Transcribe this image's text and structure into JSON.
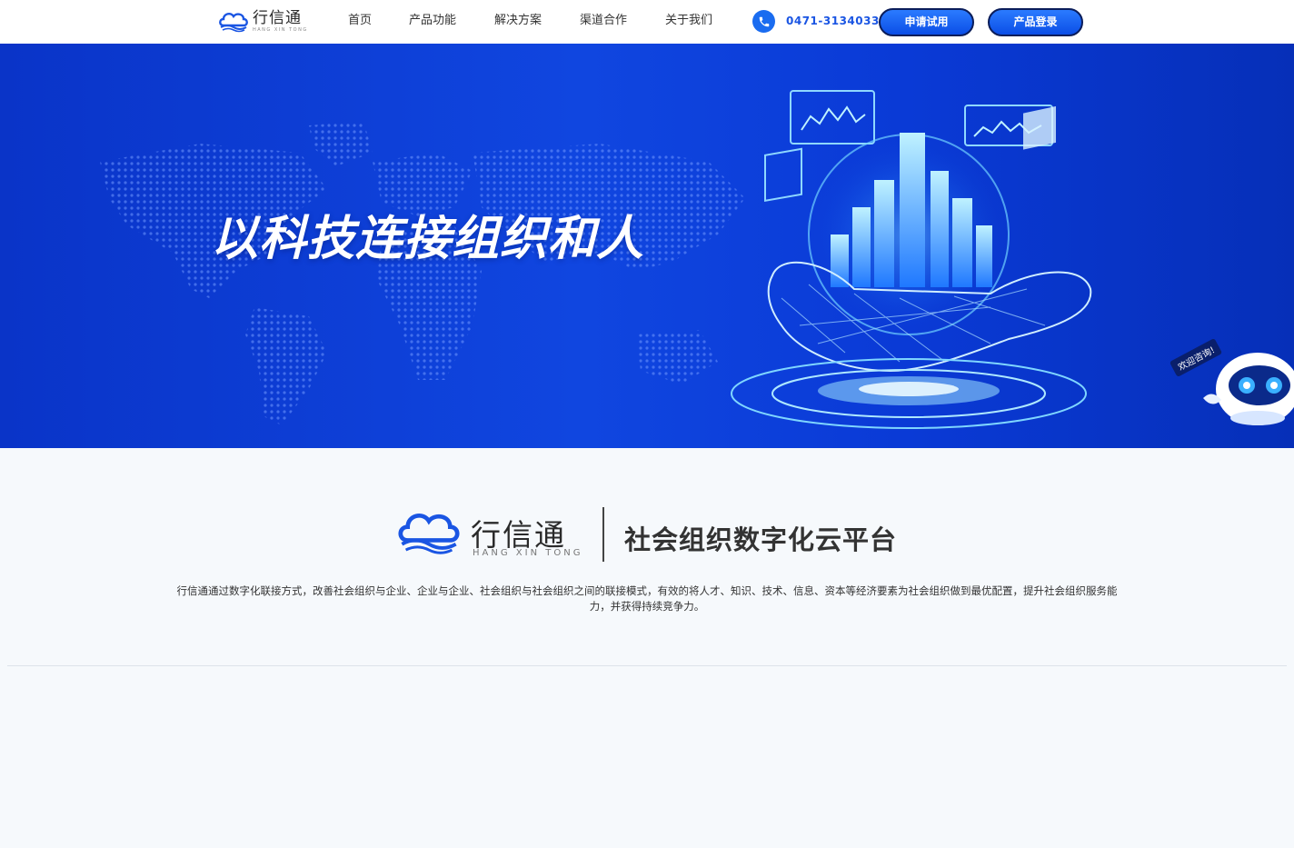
{
  "header": {
    "logo": {
      "cn": "行信通",
      "en": "HANG XIN TONG"
    },
    "nav": [
      "首页",
      "产品功能",
      "解决方案",
      "渠道合作",
      "关于我们"
    ],
    "phone": "0471-3134033",
    "trial_button": "申请试用",
    "login_button": "产品登录"
  },
  "hero": {
    "headline": "以科技连接组织和人"
  },
  "chat_bot": {
    "label": "欢迎咨询!"
  },
  "intro": {
    "brand_cn": "行信通",
    "brand_en": "HANG XIN TONG",
    "slogan": "社会组织数字化云平台",
    "description": "行信通通过数字化联接方式，改善社会组织与企业、企业与企业、社会组织与社会组织之间的联接模式，有效的将人才、知识、技术、信息、资本等经济要素为社会组织做到最优配置，提升社会组织服务能力，并获得持续竞争力。"
  },
  "colors": {
    "brand_blue": "#1a55e3",
    "hero_blue": "#0a3ad6",
    "button_blue": "#1565ff"
  },
  "icons": [
    "cloud-logo-icon",
    "phone-icon",
    "robot-icon"
  ]
}
